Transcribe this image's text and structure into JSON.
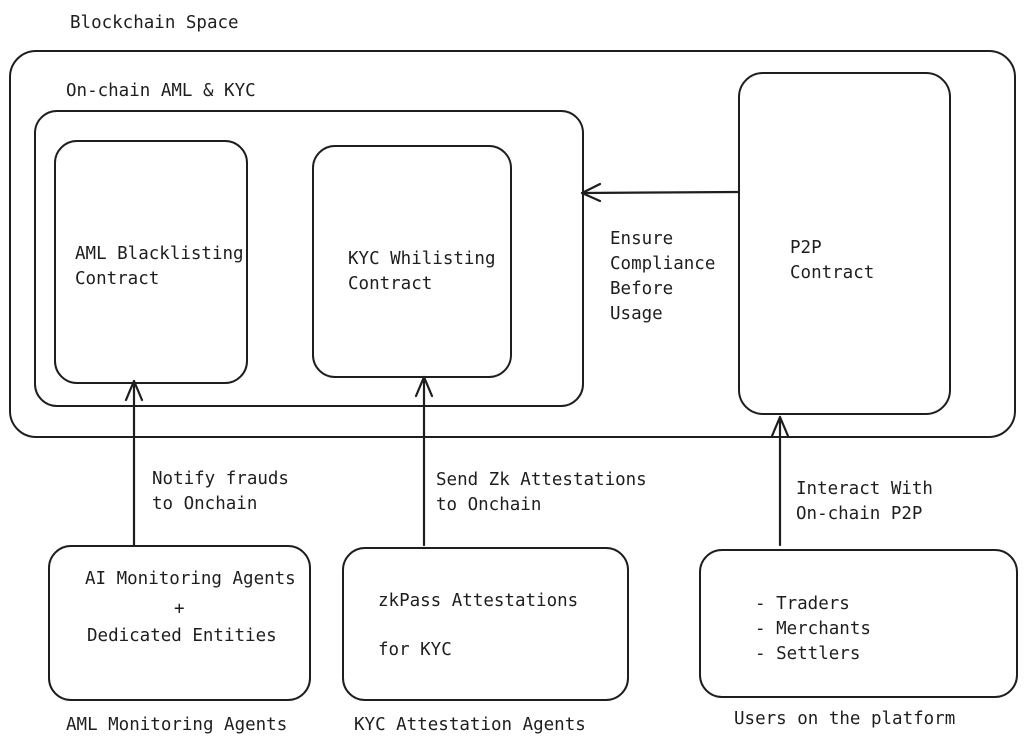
{
  "title": "Blockchain Space",
  "onchain_group": {
    "label": "On-chain AML & KYC"
  },
  "contracts": {
    "aml": [
      "AML Blacklisting",
      "Contract"
    ],
    "kyc": [
      "KYC Whilisting",
      "Contract"
    ],
    "p2p": [
      "P2P",
      "Contract"
    ]
  },
  "compliance_label": [
    "Ensure",
    "Compliance",
    "Before",
    "Usage"
  ],
  "arrow_labels": {
    "notify": [
      "Notify frauds",
      "to Onchain"
    ],
    "send": [
      "Send Zk Attestations",
      "to Onchain"
    ],
    "interact": [
      "Interact With",
      "On-chain P2P"
    ]
  },
  "agents": {
    "aml": {
      "lines": [
        "AI Monitoring Agents",
        "+",
        "Dedicated Entities"
      ],
      "caption": "AML Monitoring Agents"
    },
    "kyc": {
      "lines": [
        "zkPass Attestations",
        "for KYC"
      ],
      "caption": "KYC Attestation Agents"
    },
    "users": {
      "lines": [
        "- Traders",
        "- Merchants",
        "- Settlers"
      ],
      "caption": "Users on the platform"
    }
  }
}
